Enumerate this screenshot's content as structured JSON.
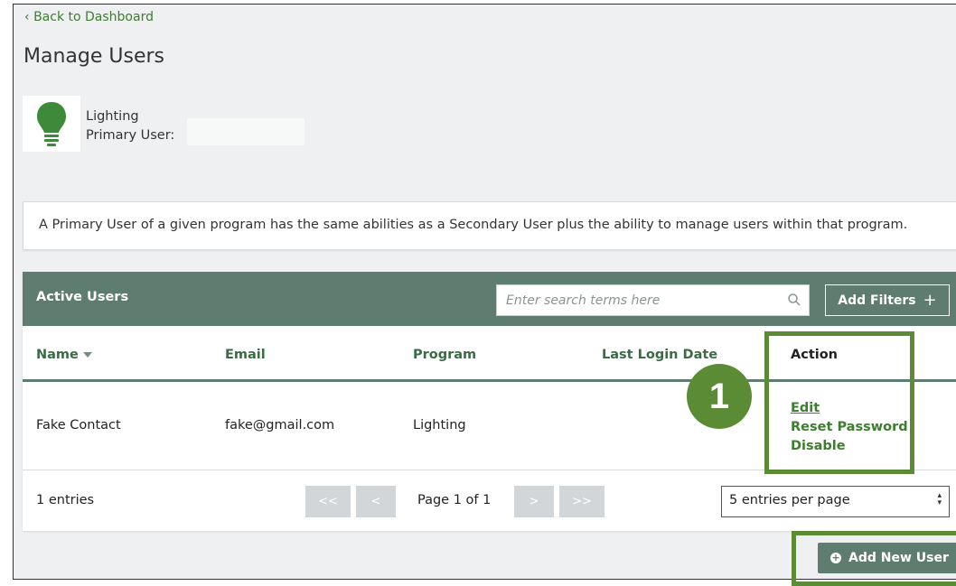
{
  "nav": {
    "back_label": "Back to Dashboard"
  },
  "page": {
    "title": "Manage Users"
  },
  "program": {
    "name": "Lighting",
    "primary_user_label": "Primary User:",
    "icon": "lightbulb-icon",
    "icon_color": "#3d8b3a"
  },
  "info": {
    "text": "A Primary User of a given program has the same abilities as a Secondary User plus the ability to manage users within that program."
  },
  "panel": {
    "title": "Active Users",
    "search_placeholder": "Enter search terms here",
    "add_filters_label": "Add Filters",
    "add_filters_icon": "+"
  },
  "table": {
    "columns": [
      "Name",
      "Email",
      "Program",
      "Last Login Date",
      "Action"
    ],
    "rows": [
      {
        "name": "Fake Contact",
        "email": "fake@gmail.com",
        "program": "Lighting",
        "last_login": "",
        "actions": [
          "Edit",
          "Reset Password",
          "Disable"
        ]
      }
    ]
  },
  "pagination": {
    "entries": "1 entries",
    "first": "<<",
    "prev": "<",
    "page_label": "Page 1 of 1",
    "next": ">",
    "last": ">>",
    "per_page": "5 entries per page"
  },
  "callout": {
    "step": "1"
  },
  "footer": {
    "add_user_label": "Add New User"
  },
  "colors": {
    "header_bg": "#5f7c70",
    "accent_green": "#3d7d2e",
    "highlight": "#5b8b34"
  }
}
